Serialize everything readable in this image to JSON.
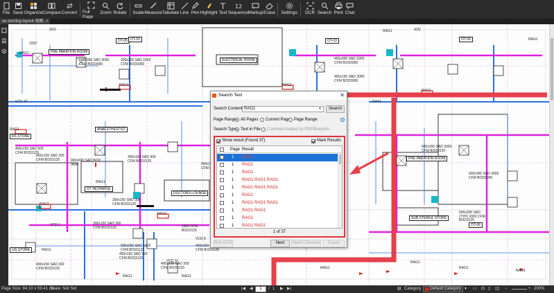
{
  "toolbar": {
    "buttons": [
      {
        "label": "File",
        "icon": "file-icon"
      },
      {
        "label": "Save",
        "icon": "save-icon"
      },
      {
        "label": "Organize",
        "icon": "organize-icon"
      },
      {
        "label": "Compare",
        "icon": "compare-icon"
      },
      {
        "label": "Convert",
        "icon": "convert-icon"
      },
      {
        "label": "Full Page",
        "icon": "full-page-icon"
      },
      {
        "label": "Zoom",
        "icon": "zoom-icon"
      },
      {
        "label": "Rotate",
        "icon": "rotate-icon"
      },
      {
        "label": "Scale",
        "icon": "scale-icon"
      },
      {
        "label": "Measure",
        "icon": "measure-icon"
      },
      {
        "label": "Tabulate",
        "icon": "tabulate-icon"
      },
      {
        "label": "Line",
        "icon": "line-icon"
      },
      {
        "label": "Pen",
        "icon": "pen-icon"
      },
      {
        "label": "Highlight",
        "icon": "highlight-icon"
      },
      {
        "label": "Text",
        "icon": "text-icon"
      },
      {
        "label": "Sequence",
        "icon": "sequence-icon"
      },
      {
        "label": "Markup",
        "icon": "markup-icon"
      },
      {
        "label": "Erase",
        "icon": "erase-icon"
      },
      {
        "label": "Settings",
        "icon": "settings-icon"
      },
      {
        "label": "OCR",
        "icon": "ocr-icon"
      },
      {
        "label": "Search",
        "icon": "search-icon"
      },
      {
        "label": "Print",
        "icon": "print-icon"
      },
      {
        "label": "Chat",
        "icon": "chat-icon"
      }
    ]
  },
  "tab": {
    "title": "ac-ducting-layout 视图…",
    "close": "×"
  },
  "plan": {
    "labels": [
      "SD2",
      "SD2",
      "RAG1",
      "RAG1",
      "RAG1",
      "RAG1",
      "RAG1",
      "RAG1",
      "RAG1",
      "RAG1",
      "RAG1",
      "RAG1",
      "RAG1",
      "RAG1",
      "RAG1",
      "RAG1",
      "RAG1",
      "RAG1",
      "RAG1"
    ],
    "room_boxes": [
      "ELECTRICAL ROOM",
      "ANAESTHESTIST",
      "DOCTORS LOUNGE",
      "OT INCHARGE",
      "PRE PARATION ROOM",
      "PRE PARATION ROOM",
      "SUB STERILE STORE",
      "OT-05",
      "OT-02",
      "OT-03",
      "OT-04",
      "OT-06",
      "RS STORE",
      "UG STORE"
    ],
    "airflow_notes": [
      "550x300 SAD 3000 CFM BOD3000",
      "300x300 SAD 1500 CFM BOD3000",
      "450x300 SAD 2000 CFM BOD3000",
      "450x150 SAD 3000 CFM BOD3000",
      "600x300 SAD 3000 CFM BOD3000",
      "400x150 SAD 500 CFM BOD3125",
      "400x150 SAD 200 CFM BOD3125",
      "900x600 SAD BOD 3600",
      "300x150 SAD 400 CFM BOD3125",
      "400x150 SAD 350 CFM BOD3125",
      "600x200 SAD 3000 CFM BOD3125",
      "500x200 SAD 1600 CFM BOD3125",
      "450x150 SAD 150 CFM BOD3125",
      "400x150 SAD 300 CFM BOD3125",
      "300x150 SAD 300 CFM BOD3125",
      "400x150 SAD 300 CFM BOD3125",
      "600x200 SAD (TYP) 2000 CFM BOD3125",
      "450x150 SAD 1150 CFM BOD3125",
      "1800 CFM BOD3125",
      "300x150 SAD 300 CFM BOD3125"
    ],
    "misc": [
      "VCD 19",
      "VCD 1",
      "VCD 11",
      "VCD 8",
      "1932",
      "RAS1"
    ]
  },
  "dialog": {
    "title": "Search Text",
    "close": "✕",
    "search_content_label": "Search Content:",
    "search_value": "RAG1",
    "search_button": "Search",
    "page_range_label": "Page Range:",
    "page_range_options": [
      "All Pages",
      "Current Page",
      "Page Range:"
    ],
    "page_range_selected": "All Pages",
    "search_type_label": "Search Type:",
    "search_type_options": [
      "Text in File",
      "Comment Added by PDFBlueprint"
    ],
    "search_type_selected": "Text in File",
    "show_result_label": "Show result (Found 37)",
    "show_result_checked": true,
    "mark_results_label": "Mark Results",
    "mark_results_checked": true,
    "columns": [
      "Page",
      "Result"
    ],
    "rows": [
      {
        "page": "1",
        "result": "RAG1",
        "selected": true
      },
      {
        "page": "1",
        "result": "RAG1",
        "selected": false
      },
      {
        "page": "1",
        "result": "RAG1",
        "selected": false
      },
      {
        "page": "1",
        "result": "RAG1 RAG1 RAG1",
        "selected": false
      },
      {
        "page": "1",
        "result": "RAG1 RAG1 RAG1",
        "selected": false
      },
      {
        "page": "1",
        "result": "RAG1",
        "selected": false
      },
      {
        "page": "1",
        "result": "RAG1 RAG1 RAG1",
        "selected": false
      },
      {
        "page": "1",
        "result": "RAG1 RAG1",
        "selected": false
      },
      {
        "page": "1",
        "result": "RAG1",
        "selected": false
      },
      {
        "page": "1",
        "result": "RAG1 RAG1",
        "selected": false
      }
    ],
    "counter": "1 of 37",
    "buttons": {
      "run_ocr": "Run OCR",
      "next": "Next",
      "mark_checked": "Mark Checked ▾",
      "export": "Export"
    }
  },
  "statusbar": {
    "page_size": "Page Size: 84.10 x 59.41 cm",
    "scale": "Scale: Not Set",
    "current_page": "1",
    "page_separator": "/",
    "total_pages": "1",
    "category_label": "Category",
    "category_value": "Default Category",
    "zoom": "200%"
  },
  "colors": {
    "accent": "#e2303a",
    "selection": "#1e73d8",
    "toolbar": "#2b2b2b",
    "duct_magenta": "#e020e0",
    "duct_blue": "#2a6fdb"
  }
}
